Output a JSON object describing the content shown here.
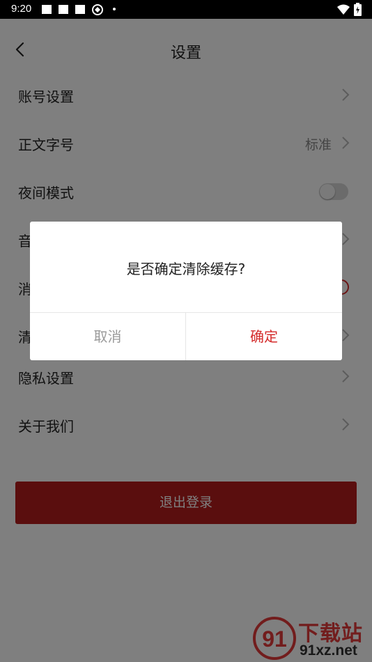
{
  "status_bar": {
    "time": "9:20"
  },
  "header": {
    "title": "设置",
    "back_icon": "chevron-left-icon"
  },
  "settings": {
    "items": [
      {
        "label": "账号设置",
        "value": ""
      },
      {
        "label": "正文字号",
        "value": "标准"
      },
      {
        "label": "夜间模式",
        "value": "",
        "toggle_on": false
      },
      {
        "label": "音",
        "value": ""
      },
      {
        "label": "消",
        "value": ""
      },
      {
        "label": "清",
        "value": ""
      },
      {
        "label": "隐私设置",
        "value": ""
      },
      {
        "label": "关于我们",
        "value": ""
      }
    ]
  },
  "logout": {
    "label": "退出登录"
  },
  "watermark": {
    "title": "下载站",
    "domain": "91xz.net",
    "logo_text": "91"
  },
  "dialog": {
    "message": "是否确定清除缓存?",
    "cancel_label": "取消",
    "confirm_label": "确定"
  },
  "colors": {
    "accent": "#d42b2b",
    "button": "#b41d1d",
    "overlay": "rgba(0,0,0,0.5)"
  }
}
